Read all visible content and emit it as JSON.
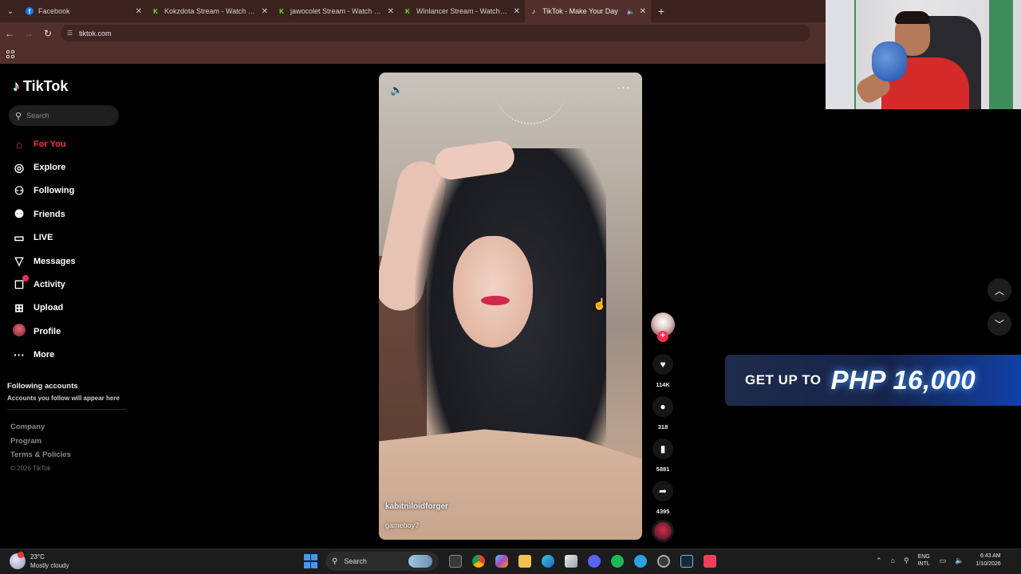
{
  "browser": {
    "tabs": [
      {
        "label": "Facebook",
        "favicon": "facebook-icon",
        "color": "#1877f2",
        "active": false
      },
      {
        "label": "Kokzdota Stream - Watch Live",
        "favicon": "kick-icon",
        "color": "#53fc18",
        "active": false
      },
      {
        "label": "jawocolet Stream - Watch Live",
        "favicon": "kick-icon",
        "color": "#53fc18",
        "active": false
      },
      {
        "label": "Winlancer Stream - Watch Live",
        "favicon": "kick-icon",
        "color": "#53fc18",
        "active": false
      },
      {
        "label": "TikTok - Make Your Day",
        "favicon": "tiktok-icon",
        "color": "#ffffff",
        "active": true
      }
    ],
    "url": "tiktok.com"
  },
  "tiktok": {
    "logo_text": "TikTok",
    "search_placeholder": "Search",
    "nav": [
      {
        "label": "For You",
        "icon": "home-icon",
        "active": true
      },
      {
        "label": "Explore",
        "icon": "compass-icon"
      },
      {
        "label": "Following",
        "icon": "following-icon"
      },
      {
        "label": "Friends",
        "icon": "friends-icon"
      },
      {
        "label": "LIVE",
        "icon": "live-icon"
      },
      {
        "label": "Messages",
        "icon": "messages-icon"
      },
      {
        "label": "Activity",
        "icon": "activity-icon",
        "badge": true
      },
      {
        "label": "Upload",
        "icon": "upload-icon"
      },
      {
        "label": "Profile",
        "icon": "profile-avatar"
      },
      {
        "label": "More",
        "icon": "more-icon"
      }
    ],
    "following_title": "Following accounts",
    "following_sub": "Accounts you follow will appear here",
    "footer_links": [
      "Company",
      "Program",
      "Terms & Policies"
    ],
    "copyright": "© 2026 TikTok",
    "video": {
      "author": "kabitniloidforger",
      "caption": "gameboy?"
    },
    "actions": {
      "likes": "114K",
      "comments": "318",
      "saves": "5881",
      "shares": "4395"
    },
    "accent": "#fe2c55"
  },
  "ad": {
    "prefix": "GET UP TO",
    "amount": "PHP 16,000"
  },
  "taskbar": {
    "weather_temp": "23°C",
    "weather_desc": "Mostly cloudy",
    "search_label": "Search",
    "lang_line1": "ENG",
    "lang_line2": "INTL",
    "time": "6:43 AM",
    "date": "1/10/2026"
  }
}
